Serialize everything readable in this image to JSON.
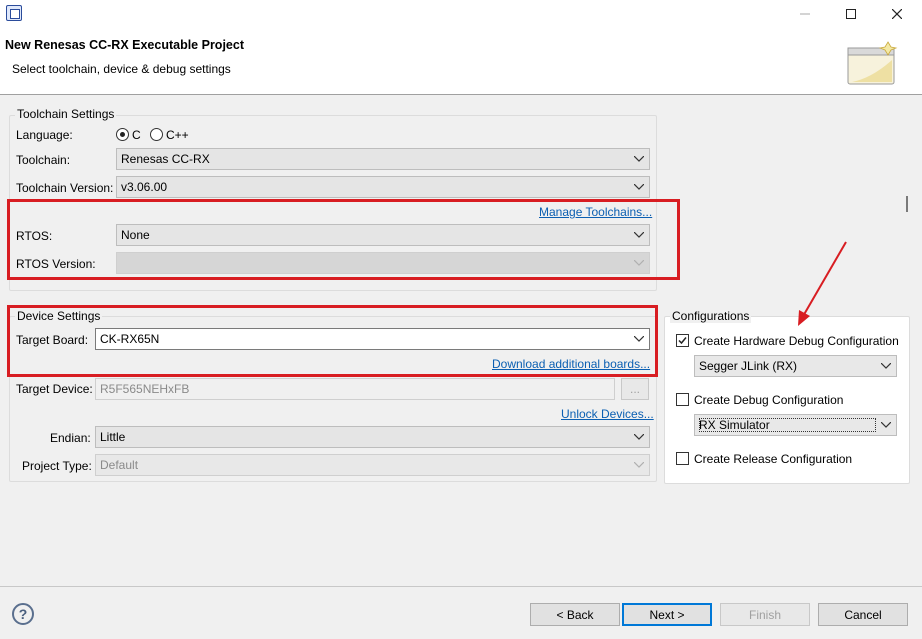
{
  "window": {
    "header_title": "New Renesas CC-RX Executable Project",
    "header_subtitle": "Select toolchain, device & debug settings"
  },
  "toolchain": {
    "group_title": "Toolchain Settings",
    "language_label": "Language:",
    "language_options": [
      "C",
      "C++"
    ],
    "language_selected": "C",
    "toolchain_label": "Toolchain:",
    "toolchain_value": "Renesas CC-RX",
    "version_label": "Toolchain Version:",
    "version_value": "v3.06.00",
    "manage_link": "Manage Toolchains...",
    "rtos_label": "RTOS:",
    "rtos_value": "None",
    "rtos_version_label": "RTOS Version:",
    "rtos_version_value": ""
  },
  "device": {
    "group_title": "Device Settings",
    "target_board_label": "Target Board:",
    "target_board_value": "CK-RX65N",
    "download_link": "Download additional boards...",
    "target_device_label": "Target Device:",
    "target_device_value": "R5F565NEHxFB",
    "browse_label": "...",
    "unlock_link": "Unlock Devices...",
    "endian_label": "Endian:",
    "endian_value": "Little",
    "project_type_label": "Project Type:",
    "project_type_value": "Default"
  },
  "configurations": {
    "group_title": "Configurations",
    "hw_debug_label": "Create Hardware Debug Configuration",
    "hw_debug_checked": true,
    "hw_debugger_value": "Segger JLink (RX)",
    "debug_label": "Create Debug Configuration",
    "debug_checked": false,
    "debugger_value": "RX Simulator",
    "release_label": "Create Release Configuration",
    "release_checked": false
  },
  "buttons": {
    "back": "< Back",
    "next": "Next >",
    "finish": "Finish",
    "cancel": "Cancel"
  },
  "colors": {
    "highlight": "#d81d22",
    "link": "#0b5fb2"
  },
  "icons": [
    "app-icon",
    "minimize-icon",
    "maximize-icon",
    "close-icon",
    "wizard-banner-icon",
    "chevron-down-icon",
    "help-icon"
  ]
}
